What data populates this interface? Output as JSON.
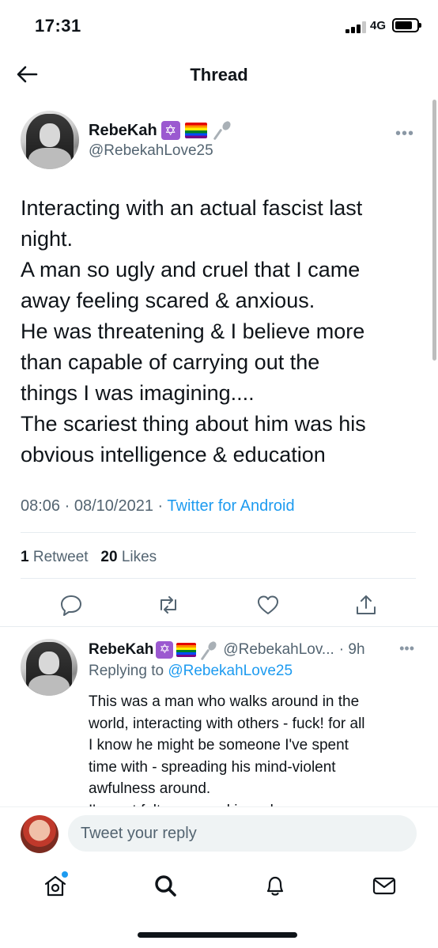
{
  "status_bar": {
    "time": "17:31",
    "network": "4G",
    "signal_bars_active": 3,
    "battery_level": 0.8
  },
  "header": {
    "title": "Thread",
    "back_icon": "arrow-left-icon"
  },
  "main_tweet": {
    "author_name": "RebeKah",
    "author_handle": "@RebekahLove25",
    "name_emojis": [
      "star-of-david-icon",
      "rainbow-flag-icon",
      "spoon-icon"
    ],
    "text_lines": [
      "Interacting with an actual fascist last",
      "night.",
      "A man so ugly and cruel that I came",
      "away feeling scared & anxious.",
      "He was threatening & I believe more",
      "than capable of carrying out the",
      "things I was imagining....",
      "The scariest thing about him was his",
      "obvious intelligence & education"
    ],
    "time": "08:06",
    "date": "08/10/2021",
    "separator": "·",
    "source": "Twitter for Android",
    "retweet_count": "1",
    "retweet_label": "Retweet",
    "like_count": "20",
    "like_label": "Likes"
  },
  "actions": [
    "reply-icon",
    "retweet-icon",
    "like-icon",
    "share-icon"
  ],
  "reply_tweet": {
    "author_name": "RebeKah",
    "author_handle": "@RebekahLov...",
    "time_ago": "· 9h",
    "replying_prefix": "Replying to",
    "replying_to": "@RebekahLove25",
    "text_lines": [
      "This was a man who walks around in the",
      "world, interacting with others - fuck! for all",
      "I know he might be someone I've spent",
      "time with - spreading his mind-violent",
      "awfulness around.",
      "I've not felt so scared in so long"
    ]
  },
  "compose": {
    "placeholder": "Tweet your reply"
  },
  "tabbar": {
    "items": [
      "home-icon",
      "search-icon",
      "notifications-icon",
      "messages-icon"
    ]
  },
  "colors": {
    "accent": "#1d9bf0",
    "text": "#0f1419",
    "secondary": "#536471"
  }
}
